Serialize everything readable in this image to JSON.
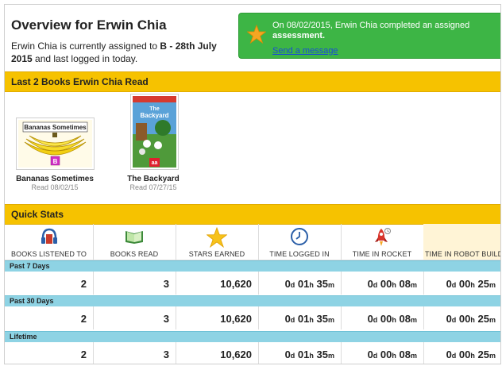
{
  "header": {
    "title": "Overview for Erwin Chia",
    "assign_prefix": "Erwin Chia is currently assigned to ",
    "assign_level": "B - 28th July 2015",
    "assign_suffix": " and last logged in today."
  },
  "notice": {
    "text_prefix": "On 08/02/2015, Erwin Chia completed an assigned ",
    "text_bold": "assessment.",
    "link": "Send a message",
    "icon": "star-icon"
  },
  "books_section": {
    "title": "Last 2 Books Erwin Chia Read",
    "books": [
      {
        "title": "Bananas Sometimes",
        "date": "Read 08/02/15",
        "cover_title": "Bananas Sometimes",
        "level_badge": "B"
      },
      {
        "title": "The Backyard",
        "date": "Read 07/27/15",
        "cover_title": "The Backyard",
        "level_badge": "aa"
      }
    ]
  },
  "quick_stats": {
    "title": "Quick Stats",
    "columns": [
      {
        "label": "BOOKS LISTENED TO",
        "icon": "headphones-book-icon"
      },
      {
        "label": "BOOKS READ",
        "icon": "open-book-icon"
      },
      {
        "label": "STARS EARNED",
        "icon": "star-icon"
      },
      {
        "label": "TIME LOGGED IN",
        "icon": "clock-icon"
      },
      {
        "label": "TIME IN ROCKET",
        "icon": "rocket-icon"
      },
      {
        "label": "TIME IN ROBOT BUILDER",
        "icon": "robot-icon"
      }
    ],
    "periods": [
      {
        "label": "Past 7 Days",
        "values": [
          "2",
          "3",
          "10,620"
        ],
        "times": [
          {
            "d": "0",
            "h": "01",
            "m": "35"
          },
          {
            "d": "0",
            "h": "00",
            "m": "08"
          },
          {
            "d": "0",
            "h": "00",
            "m": "25"
          }
        ]
      },
      {
        "label": "Past 30 Days",
        "values": [
          "2",
          "3",
          "10,620"
        ],
        "times": [
          {
            "d": "0",
            "h": "01",
            "m": "35"
          },
          {
            "d": "0",
            "h": "00",
            "m": "08"
          },
          {
            "d": "0",
            "h": "00",
            "m": "25"
          }
        ]
      },
      {
        "label": "Lifetime",
        "values": [
          "2",
          "3",
          "10,620"
        ],
        "times": [
          {
            "d": "0",
            "h": "01",
            "m": "35"
          },
          {
            "d": "0",
            "h": "00",
            "m": "08"
          },
          {
            "d": "0",
            "h": "00",
            "m": "25"
          }
        ]
      }
    ],
    "unit_labels": {
      "d": "d",
      "h": "h",
      "m": "m"
    }
  },
  "colors": {
    "section_bar": "#f6c200",
    "period_bar": "#8ed3e4",
    "notice_bg": "#3db545",
    "star": "#f5a623"
  }
}
